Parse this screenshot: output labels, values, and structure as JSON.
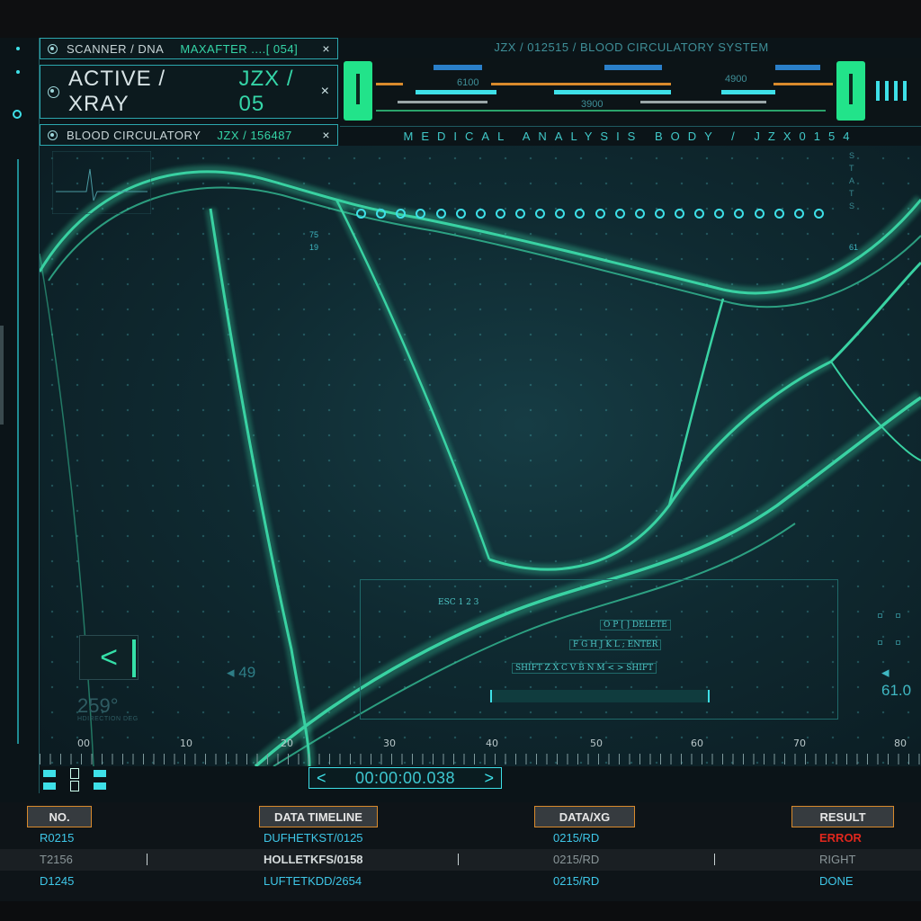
{
  "tabs": {
    "scanner": {
      "label": "SCANNER / DNA",
      "code": "MAXAFTER ....[ 054]",
      "close": "×"
    },
    "active": {
      "label": "ACTIVE / XRAY",
      "code": "JZX / 05",
      "close": "×"
    },
    "blood": {
      "label": "BLOOD CIRCULATORY",
      "code": "JZX / 156487",
      "close": "×"
    }
  },
  "header": {
    "title": "JZX / 012515 / BLOOD CIRCULATORY SYSTEM",
    "subtitle": "MEDICAL ANALYSIS BODY / JZX0154",
    "scale_left": "6100",
    "scale_mid": "3900",
    "scale_right": "4900"
  },
  "viewport": {
    "stats_label": "STATS",
    "stats_numbers": "61",
    "left_numbers": "7519",
    "back_button": "<",
    "degrees": "259°",
    "degrees_sub": "HDIRECTION DEG",
    "left_value": "49",
    "right_value": "61.0",
    "keyboard": {
      "row1": "ESC 1 2 3",
      "row2": "O P [ ] DELETE",
      "row3": "F G H J K L ; ENTER",
      "row4": "SHIFT Z X C V B N M < > SHIFT"
    },
    "ruler": [
      "00",
      "10",
      "20",
      "30",
      "40",
      "50",
      "60",
      "70",
      "80"
    ]
  },
  "timeline": {
    "prev": "<",
    "value": "00:00:00.038",
    "next": ">"
  },
  "table": {
    "headers": [
      "NO.",
      "DATA TIMELINE",
      "DATA/XG",
      "RESULT"
    ],
    "rows": [
      {
        "no": "R0215",
        "timeline": "DUFHETKST/0125",
        "data": "0215/RD",
        "result": "ERROR"
      },
      {
        "no": "T2156",
        "timeline": "HOLLETKFS/0158",
        "data": "0215/RD",
        "result": "RIGHT"
      },
      {
        "no": "D1245",
        "timeline": "LUFTETKDD/2654",
        "data": "0215/RD",
        "result": "DONE"
      }
    ]
  },
  "colors": {
    "accent": "#3ee0e8",
    "green": "#22e38a",
    "orange": "#d98a2c",
    "error": "#e0271d"
  }
}
